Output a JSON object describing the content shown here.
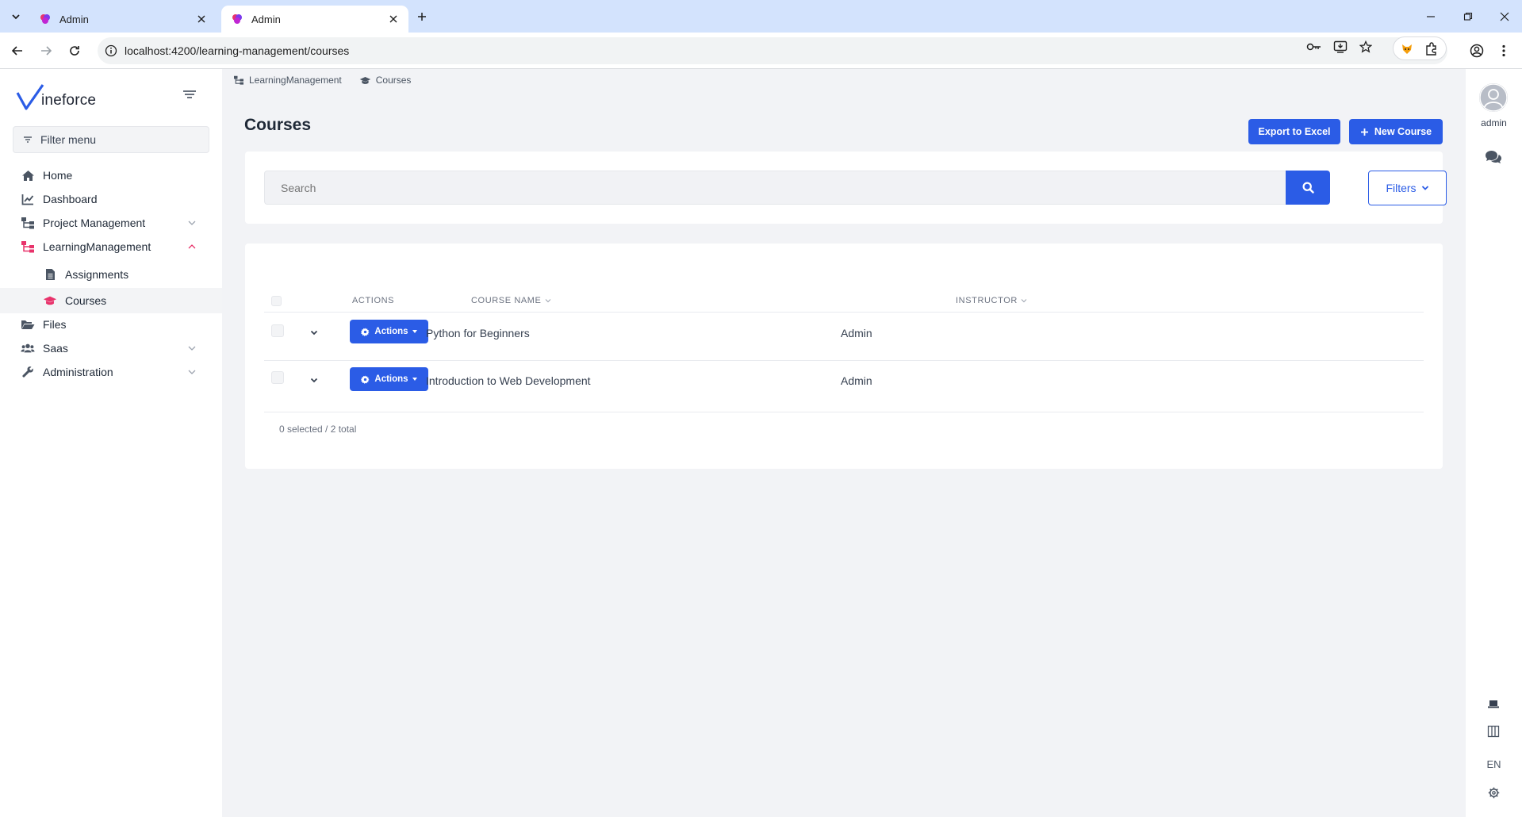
{
  "browser": {
    "tabs": [
      {
        "title": "Admin",
        "active": false
      },
      {
        "title": "Admin",
        "active": true
      }
    ],
    "url": "localhost:4200/learning-management/courses"
  },
  "sidebar": {
    "logo_text": "ineforce",
    "filter_placeholder": "Filter menu",
    "items": [
      {
        "label": "Home",
        "icon": "home-icon"
      },
      {
        "label": "Dashboard",
        "icon": "chart-line-icon"
      },
      {
        "label": "Project Management",
        "icon": "sitemap-icon"
      },
      {
        "label": "LearningManagement",
        "icon": "sitemap-icon"
      },
      {
        "label": "Assignments",
        "icon": "file-icon"
      },
      {
        "label": "Courses",
        "icon": "graduation-cap-icon"
      },
      {
        "label": "Files",
        "icon": "folder-open-icon"
      },
      {
        "label": "Saas",
        "icon": "users-icon"
      },
      {
        "label": "Administration",
        "icon": "wrench-icon"
      }
    ]
  },
  "breadcrumb": [
    {
      "label": "LearningManagement",
      "icon": "sitemap-icon"
    },
    {
      "label": "Courses",
      "icon": "graduation-cap-icon"
    }
  ],
  "page": {
    "title": "Courses",
    "export_label": "Export to Excel",
    "new_label": "New Course"
  },
  "search": {
    "placeholder": "Search",
    "filters_label": "Filters"
  },
  "table": {
    "columns": [
      "ACTIONS",
      "COURSE NAME",
      "INSTRUCTOR"
    ],
    "action_label": "Actions",
    "rows": [
      {
        "course_name": "Python for Beginners",
        "instructor": "Admin"
      },
      {
        "course_name": "Introduction to Web Development",
        "instructor": "Admin"
      }
    ],
    "footer": "0 selected / 2 total"
  },
  "right_rail": {
    "user": "admin",
    "language": "EN"
  },
  "colors": {
    "primary": "#2b5ce6",
    "accent": "#e8336b",
    "tabstrip": "#d3e3fd"
  }
}
